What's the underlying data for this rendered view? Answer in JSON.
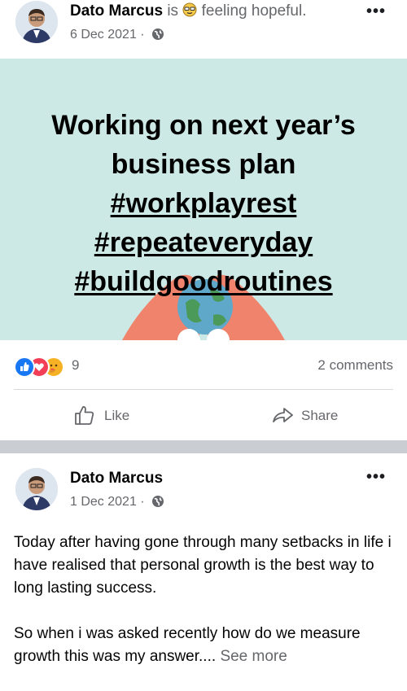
{
  "post1": {
    "author": "Dato Marcus",
    "activity_text": "feeling hopeful.",
    "activity_prefix": "is",
    "activity_icon": "face-with-glasses-emoji",
    "date": "6 Dec 2021",
    "separator_dot": "·",
    "privacy_icon": "globe-icon",
    "more_label": "•••",
    "image": {
      "line1": "Working on next year’s",
      "line2": "business plan",
      "tag1": "#workplayrest",
      "tag2": "#repeateveryday",
      "tag3": "#buildgoodroutines",
      "bg_color": "#cde9e6"
    },
    "reactions": {
      "icons": [
        "like-reaction-icon",
        "love-reaction-icon",
        "care-reaction-icon"
      ],
      "count": "9",
      "comments": "2 comments"
    },
    "actions": {
      "like": "Like",
      "share": "Share"
    }
  },
  "post2": {
    "author": "Dato Marcus",
    "date": "1 Dec 2021",
    "separator_dot": "·",
    "privacy_icon": "globe-icon",
    "more_label": "•••",
    "paragraph1": "Today after having gone through many setbacks in life i have realised that personal growth is the best way to long lasting success.",
    "paragraph2": "So when i was asked recently how do we measure growth this was my answer....",
    "see_more": "See more"
  },
  "colors": {
    "like_blue": "#1877f2",
    "love_red": "#f33e58",
    "care_yellow": "#f7b125",
    "muted_text": "#65676b",
    "separator": "#cacdd1"
  }
}
